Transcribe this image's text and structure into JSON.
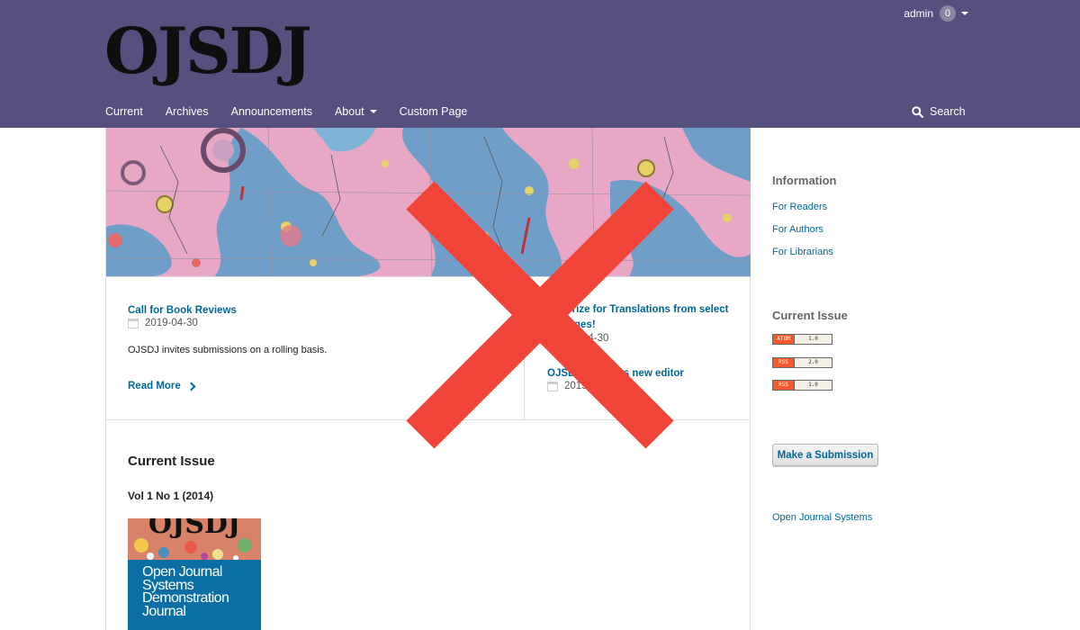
{
  "header": {
    "logo_text": "OJSDJ",
    "user": {
      "name": "admin",
      "task_count": "0"
    },
    "nav": [
      {
        "label": "Current",
        "has_dropdown": false
      },
      {
        "label": "Archives",
        "has_dropdown": false
      },
      {
        "label": "Announcements",
        "has_dropdown": false
      },
      {
        "label": "About",
        "has_dropdown": true
      },
      {
        "label": "Custom Page",
        "has_dropdown": false
      }
    ],
    "search_label": "Search",
    "search_icon": "search-icon"
  },
  "announcements": [
    {
      "title": "Call for Book Reviews",
      "date": "2019-04-30",
      "summary": "OJSDJ invites submissions on a rolling basis.",
      "read_more": "Read More"
    },
    {
      "title_line1": "Prize for Translations from select",
      "title_line2": "ges!",
      "date": "04-30"
    },
    {
      "title_left": "OJSD",
      "title_right": "its new editor",
      "date": "2019"
    }
  ],
  "current_issue": {
    "heading": "Current Issue",
    "volume": "Vol 1 No 1 (2014)",
    "cover": {
      "masthead": "OJSDJ",
      "line1": "Open Journal",
      "line2": "Systems",
      "line3": "Demonstration",
      "line4": "Journal"
    }
  },
  "sidebar": {
    "information": {
      "title": "Information",
      "links": [
        "For Readers",
        "For Authors",
        "For Librarians"
      ]
    },
    "current_issue": {
      "title": "Current Issue",
      "feeds": [
        {
          "left": "ATOM",
          "right": "1.0"
        },
        {
          "left": "RSS",
          "right": "2.0"
        },
        {
          "left": "RSS",
          "right": "1.0"
        }
      ]
    },
    "submission_button": "Make a Submission",
    "footer_link": "Open Journal Systems"
  },
  "colors": {
    "header_bg": "#55507e",
    "link": "#006798",
    "overlay_red": "#f04438"
  }
}
